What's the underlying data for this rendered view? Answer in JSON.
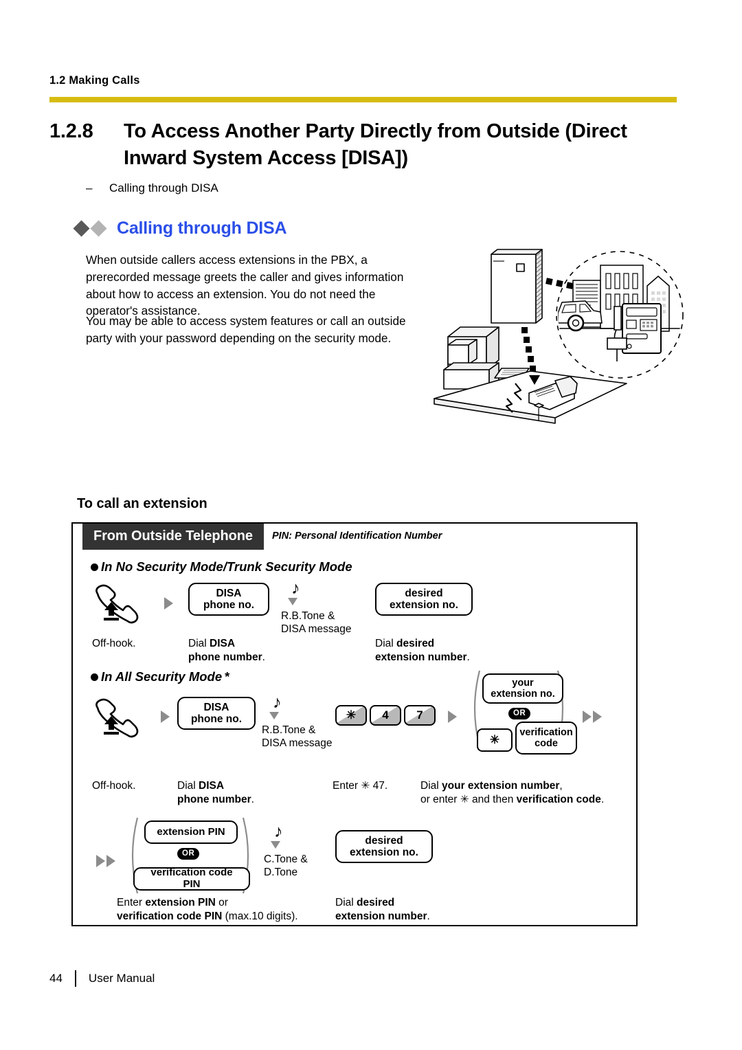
{
  "header": {
    "running_head": "1.2 Making Calls",
    "rule_color": "#d6bc10"
  },
  "section": {
    "number": "1.2.8",
    "title_line1": "To Access Another Party Directly from Outside (Direct",
    "title_line2": "Inward System Access [DISA])",
    "dash": "–",
    "dash_item": "Calling through DISA"
  },
  "topic": {
    "heading": "Calling through DISA",
    "heading_color": "#2b4fe8",
    "paragraph1": "When outside callers access extensions in the PBX, a prerecorded message greets the caller and gives information about how to access an extension. You do not need the operator's assistance.",
    "paragraph2": "You may be able to access system features or call an outside party with your password depending on the security mode."
  },
  "illustration": {
    "name": "disa-system-illustration",
    "elements": [
      "pbx-cabinet",
      "desktop-computer",
      "desk-telephone",
      "city-buildings",
      "car",
      "payphone",
      "dotted-call-path"
    ]
  },
  "subhead": "To call an extension",
  "flow": {
    "band_label": "From Outside Telephone",
    "pin_note": "PIN: Personal Identification Number",
    "mode1": {
      "heading": "In No Security Mode/Trunk Security Mode",
      "steps": {
        "offhook_icon": "off-hook-handset-icon",
        "box_disa_l1": "DISA",
        "box_disa_l2": "phone no.",
        "tone_l1": "R.B.Tone &",
        "tone_l2": "DISA message",
        "box_ext_l1": "desired",
        "box_ext_l2": "extension no."
      },
      "captions": {
        "c1": "Off-hook.",
        "c2_l1_plain": "Dial ",
        "c2_l1_bold": "DISA",
        "c2_l2_bold": "phone number",
        "c2_l2_tail": ".",
        "c3_l1_plain": "Dial ",
        "c3_l1_bold": "desired",
        "c3_l2_bold": "extension number",
        "c3_l2_tail": "."
      }
    },
    "mode2": {
      "heading": "In All Security Mode",
      "heading_mark": "*",
      "steps": {
        "box_disa_l1": "DISA",
        "box_disa_l2": "phone no.",
        "tone_l1": "R.B.Tone &",
        "tone_l2": "DISA message",
        "keys": [
          "✳",
          "4",
          "7"
        ],
        "group1_box1_l1": "your",
        "group1_box1_l2": "extension no.",
        "group1_or": "OR",
        "group1_key": "✳",
        "group1_box2_l1": "verification",
        "group1_box2_l2": "code",
        "group2_box1": "extension PIN",
        "group2_or": "OR",
        "group2_box2": "verification code PIN",
        "tone2_l1": "C.Tone &",
        "tone2_l2": "D.Tone",
        "box_ext_l1": "desired",
        "box_ext_l2": "extension no."
      },
      "captions": {
        "c1": "Off-hook.",
        "c2_l1_plain": "Dial ",
        "c2_l1_bold": "DISA",
        "c2_l2_bold": "phone number",
        "c2_l2_tail": ".",
        "c3": "Enter ✳ 47.",
        "c4_l1_plain": "Dial ",
        "c4_l1_bold": "your extension number",
        "c4_l1_tail": ",",
        "c4_l2_plain": "or enter ✳ and then ",
        "c4_l2_bold": "verification code",
        "c4_l2_tail": ".",
        "c5_l1_plain": "Enter ",
        "c5_l1_bold": "extension PIN",
        "c5_l1_tail": " or",
        "c5_l2_bold": "verification code PIN",
        "c5_l2_tail": " (max.10 digits).",
        "c6_l1_plain": "Dial ",
        "c6_l1_bold": "desired",
        "c6_l2_bold": "extension number",
        "c6_l2_tail": "."
      }
    }
  },
  "footer": {
    "page_number": "44",
    "doc_name": "User Manual"
  }
}
